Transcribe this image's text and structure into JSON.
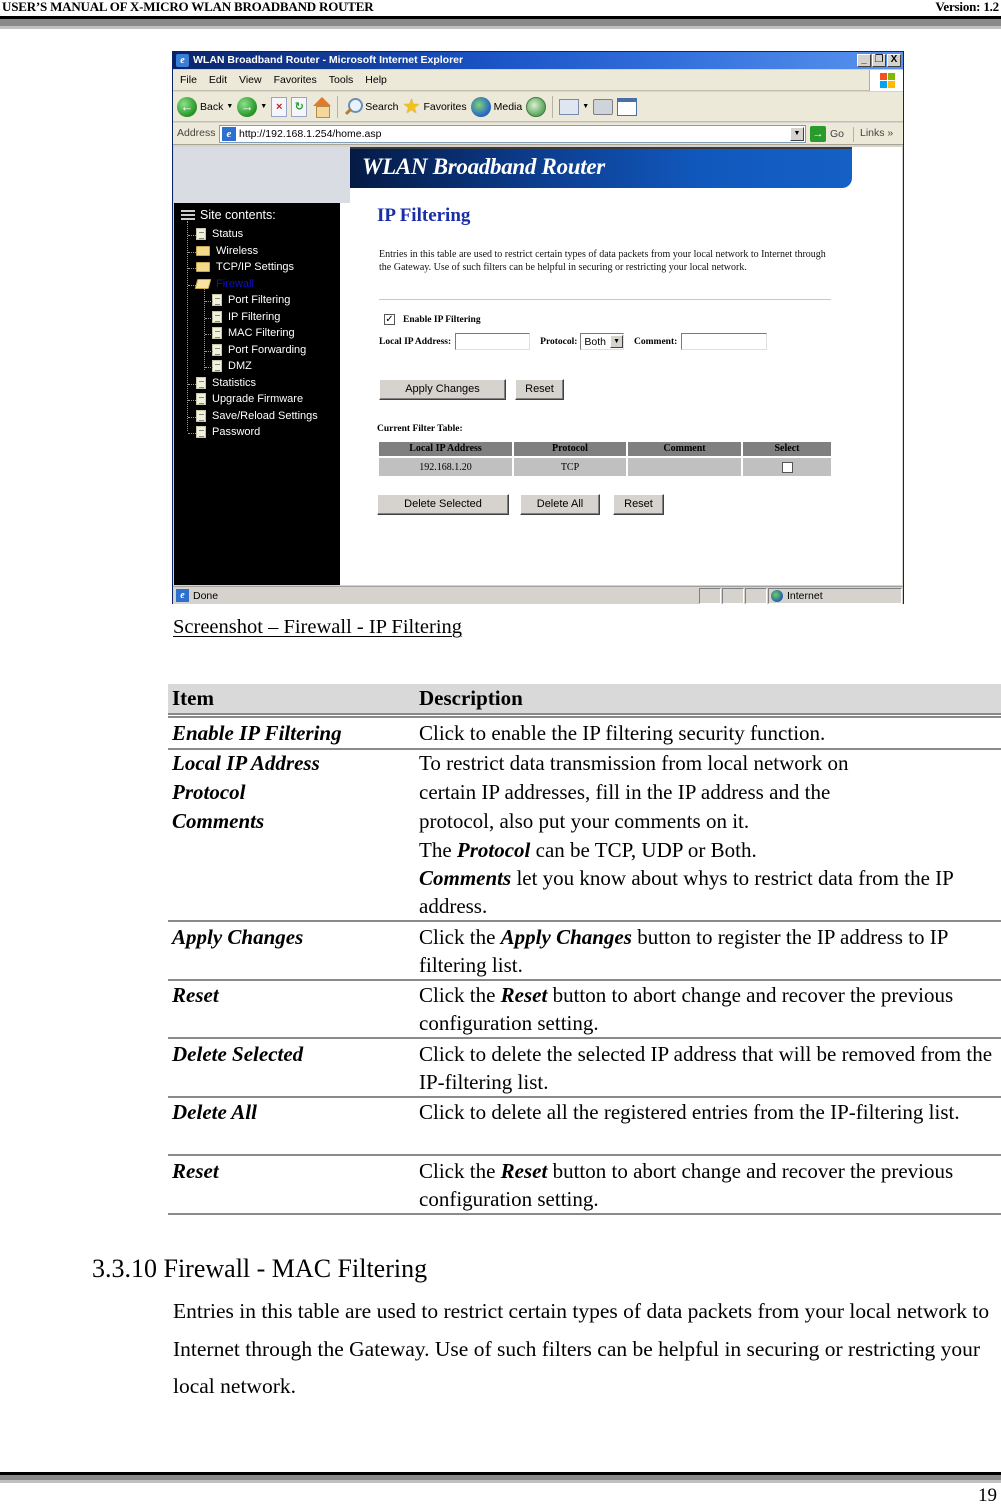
{
  "page_header": {
    "title": "USER’S MANUAL OF X-MICRO WLAN BROADBAND ROUTER",
    "version": "Version: 1.2"
  },
  "browser": {
    "window_title": "WLAN Broadband Router - Microsoft Internet Explorer",
    "window_buttons": [
      "_",
      "❐",
      "X"
    ],
    "menu": [
      "File",
      "Edit",
      "View",
      "Favorites",
      "Tools",
      "Help"
    ],
    "toolbar": {
      "back": "Back",
      "search": "Search",
      "favorites": "Favorites",
      "media": "Media"
    },
    "address_label": "Address",
    "address_url": "http://192.168.1.254/home.asp",
    "go_label": "Go",
    "links_label": "Links »",
    "status_text": "Done",
    "status_zone": "Internet"
  },
  "router_page": {
    "banner": "WLAN Broadband Router",
    "sidebar": {
      "header": "Site contents:",
      "items": [
        {
          "label": "Status",
          "icon": "page-icon",
          "level": 0
        },
        {
          "label": "Wireless",
          "icon": "folder-icon",
          "level": 0
        },
        {
          "label": "TCP/IP Settings",
          "icon": "folder-icon",
          "level": 0
        },
        {
          "label": "Firewall",
          "icon": "folder-open-icon",
          "level": 0,
          "active": true
        },
        {
          "label": "Port Filtering",
          "icon": "page-icon",
          "level": 1
        },
        {
          "label": "IP Filtering",
          "icon": "page-icon",
          "level": 1
        },
        {
          "label": "MAC Filtering",
          "icon": "page-icon",
          "level": 1
        },
        {
          "label": "Port Forwarding",
          "icon": "page-icon",
          "level": 1
        },
        {
          "label": "DMZ",
          "icon": "page-icon",
          "level": 1
        },
        {
          "label": "Statistics",
          "icon": "page-icon",
          "level": 0
        },
        {
          "label": "Upgrade Firmware",
          "icon": "page-icon",
          "level": 0
        },
        {
          "label": "Save/Reload Settings",
          "icon": "page-icon",
          "level": 0
        },
        {
          "label": "Password",
          "icon": "page-icon",
          "level": 0
        }
      ]
    },
    "title": "IP Filtering",
    "intro": "Entries in this table are used to restrict certain types of data packets from your local network to Internet through the Gateway. Use of such filters can be helpful in securing or restricting your local network.",
    "enable_label": "Enable IP Filtering",
    "enable_checked": true,
    "local_ip_label": "Local IP Address:",
    "local_ip_value": "",
    "protocol_label": "Protocol:",
    "protocol_value": "Both",
    "comment_label": "Comment:",
    "comment_value": "",
    "apply_button": "Apply Changes",
    "reset_button": "Reset",
    "table_caption": "Current Filter Table:",
    "table_headers": [
      "Local IP Address",
      "Protocol",
      "Comment",
      "Select"
    ],
    "table_rows": [
      {
        "ip": "192.168.1.20",
        "protocol": "TCP",
        "comment": "",
        "selected": false
      }
    ],
    "delete_selected_button": "Delete Selected",
    "delete_all_button": "Delete All",
    "reset2_button": "Reset"
  },
  "document": {
    "caption": "Screenshot – Firewall - IP Filtering",
    "table_header": {
      "item": "Item",
      "description": "Description"
    },
    "rows": [
      {
        "items": [
          "Enable IP Filtering"
        ],
        "desc": "Click to enable the IP filtering security function."
      },
      {
        "items": [
          "Local IP Address",
          "Protocol",
          "Comments"
        ],
        "desc_lines": [
          "To restrict data transmission from local network on",
          "certain IP addresses, fill in the IP address and the",
          "protocol, also put your comments on it."
        ],
        "desc_protocol": {
          "pre": "The ",
          "bold": "Protocol",
          "post": " can be TCP, UDP or Both."
        },
        "desc_comments": {
          "bold": "Comments",
          "post": " let you know about whys to restrict data from the IP address."
        }
      },
      {
        "items": [
          "Apply Changes"
        ],
        "desc": {
          "pre": "Click the ",
          "bold": "Apply Changes",
          "post": " button to register the IP address to IP filtering list."
        }
      },
      {
        "items": [
          "Reset"
        ],
        "desc": {
          "pre": "Click the ",
          "bold": "Reset",
          "post": " button to abort change and recover the previous configuration setting."
        }
      },
      {
        "items": [
          "Delete Selected"
        ],
        "desc": "Click to delete the selected IP address that will be removed from the IP-filtering list."
      },
      {
        "items": [
          "Delete All"
        ],
        "desc": "Click to delete all the registered entries from the IP-filtering list."
      },
      {
        "items": [
          "Reset"
        ],
        "desc": {
          "pre": "Click the ",
          "bold": "Reset",
          "post": " button to abort change and recover the previous configuration setting."
        }
      }
    ],
    "section_title": "3.3.10 Firewall - MAC Filtering",
    "section_body": "Entries in this table are used to restrict certain types of data packets from your local network to Internet through the Gateway. Use of such filters can be helpful in securing or restricting your local network."
  },
  "page_number": "19"
}
